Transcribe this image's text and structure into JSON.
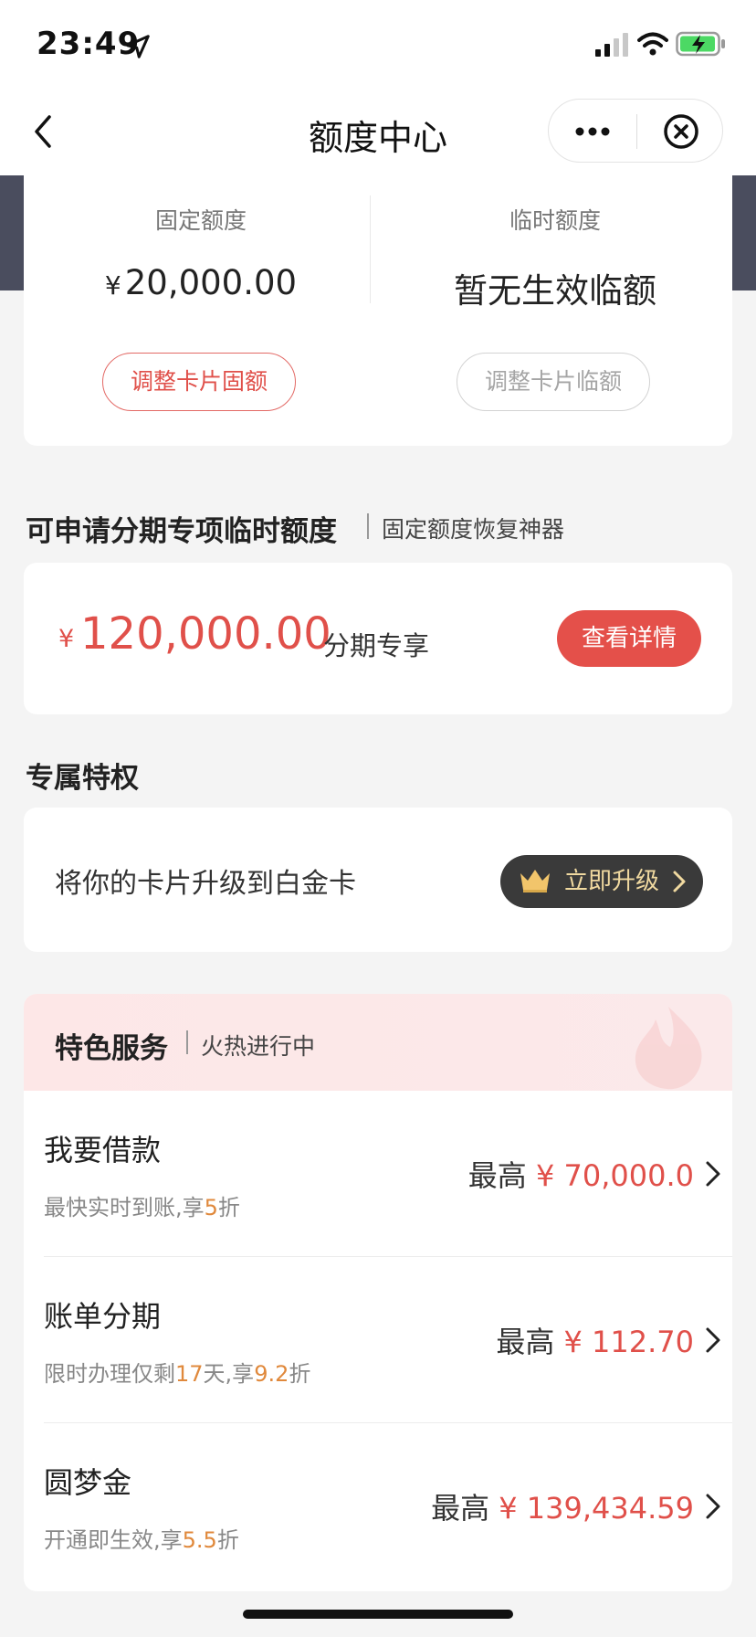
{
  "status_bar": {
    "time": "23:49"
  },
  "nav": {
    "title": "额度中心"
  },
  "limits": {
    "fixed": {
      "label": "固定额度",
      "currency": "¥",
      "value": "20,000.00",
      "button": "调整卡片固额"
    },
    "temp": {
      "label": "临时额度",
      "value": "暂无生效临额",
      "button": "调整卡片临额"
    }
  },
  "installment_section": {
    "title": "可申请分期专项临时额度",
    "subtitle": "固定额度恢复神器",
    "currency": "¥",
    "amount": "120,000.00",
    "tag": "分期专享",
    "button": "查看详情"
  },
  "privilege_section": {
    "title": "专属特权",
    "text": "将你的卡片升级到白金卡",
    "button": "立即升级"
  },
  "services": {
    "title": "特色服务",
    "subtitle": "火热进行中",
    "items": [
      {
        "name": "我要借款",
        "desc_pre": "最快实时到账,享",
        "desc_hl1": "5",
        "desc_mid": "折",
        "desc_hl2": "",
        "desc_post": "",
        "max_label": "最高",
        "amount": "¥ 70,000.0"
      },
      {
        "name": "账单分期",
        "desc_pre": "限时办理仅剩",
        "desc_hl1": "17",
        "desc_mid": "天,享",
        "desc_hl2": "9.2",
        "desc_post": "折",
        "max_label": "最高",
        "amount": "¥ 112.70"
      },
      {
        "name": "圆梦金",
        "desc_pre": "开通即生效,享",
        "desc_hl1": "5.5",
        "desc_mid": "折",
        "desc_hl2": "",
        "desc_post": "",
        "max_label": "最高",
        "amount": "¥ 139,434.59"
      }
    ]
  },
  "colors": {
    "accent_red": "#e4504a",
    "highlight_orange": "#e0893c",
    "banner": "#4a4d5e"
  }
}
